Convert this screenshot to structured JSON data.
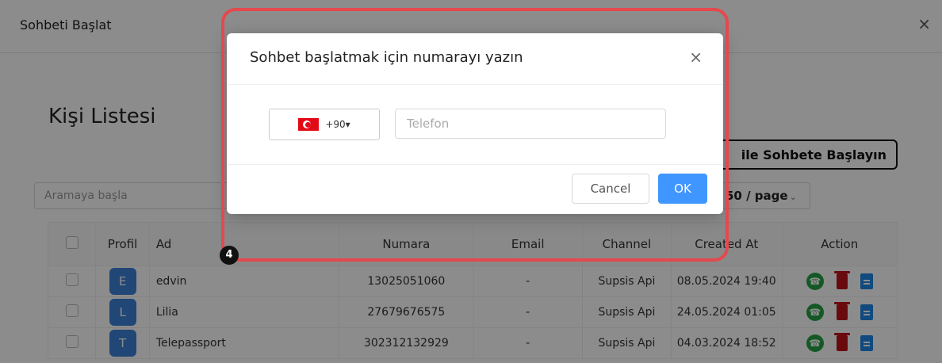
{
  "window": {
    "title": "Sohbeti Başlat",
    "close_symbol": "×"
  },
  "contacts": {
    "title": "Kişi Listesi",
    "whatsapp_button": "ile Sohbete Başlayın",
    "search_placeholder": "Aramaya başla",
    "page_size": "50 / page",
    "columns": [
      "Profil",
      "Ad",
      "Numara",
      "Email",
      "Channel",
      "Created At",
      "Action"
    ],
    "rows": [
      {
        "initial": "E",
        "name": "edvin",
        "number": "13025051060",
        "email": "-",
        "channel": "Supsis Api",
        "created": "08.05.2024 19:40"
      },
      {
        "initial": "L",
        "name": "Lilia",
        "number": "27679676575",
        "email": "-",
        "channel": "Supsis Api",
        "created": "24.05.2024 01:05"
      },
      {
        "initial": "T",
        "name": "Telepassport",
        "number": "302312132929",
        "email": "-",
        "channel": "Supsis Api",
        "created": "04.03.2024 18:52"
      }
    ]
  },
  "dialog": {
    "title": "Sohbet başlatmak için numarayı yazın",
    "close_symbol": "×",
    "country_code": "+90",
    "phone_placeholder": "Telefon",
    "phone_value": "",
    "cancel_label": "Cancel",
    "ok_label": "OK"
  },
  "annotation": {
    "marker_number": "4",
    "highlight_color": "#e5484d"
  },
  "colors": {
    "primary": "#4096ff",
    "avatar": "#3b82d6",
    "whatsapp": "#25a244",
    "delete": "#c0151b",
    "document": "#1e88e5"
  },
  "icons": {
    "flag": "turkey-flag-icon",
    "whatsapp": "whatsapp-icon",
    "delete": "trash-icon",
    "document": "contact-document-icon"
  }
}
